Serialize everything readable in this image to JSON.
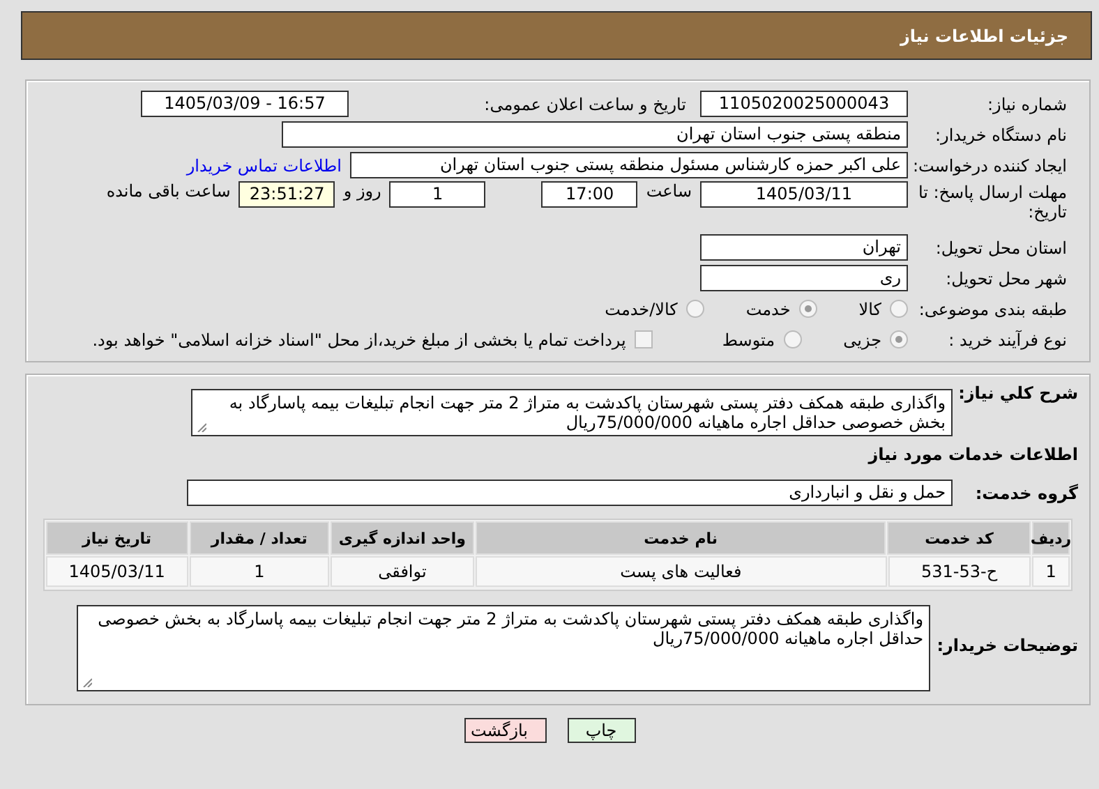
{
  "title": "جزئیات اطلاعات نیاز",
  "need_number": {
    "label": "شماره نیاز:",
    "value": "1105020025000043"
  },
  "announce": {
    "label": "تاریخ و ساعت اعلان عمومی:",
    "value": "1405/03/09 - 16:57"
  },
  "buyer": {
    "label": "نام دستگاه خریدار:",
    "value": "منطقه پستی جنوب استان تهران"
  },
  "creator": {
    "label": "ایجاد کننده درخواست:",
    "value": "علی اکبر حمزه کارشناس مسئول منطقه پستی جنوب استان تهران",
    "link": "اطلاعات تماس خریدار"
  },
  "deadline": {
    "label": "مهلت ارسال پاسخ: تا تاریخ:",
    "date": "1405/03/11",
    "time_label": "ساعت",
    "time": "17:00",
    "days": "1",
    "days_label": "روز و",
    "remaining": "23:51:27",
    "remaining_label": "ساعت باقی مانده"
  },
  "province": {
    "label": "استان محل تحویل:",
    "value": "تهران"
  },
  "city": {
    "label": "شهر محل تحویل:",
    "value": "ری"
  },
  "category": {
    "label": "طبقه بندی موضوعی:",
    "options": [
      {
        "label": "کالا",
        "selected": false
      },
      {
        "label": "خدمت",
        "selected": true
      },
      {
        "label": "کالا/خدمت",
        "selected": false
      }
    ]
  },
  "process": {
    "label": "نوع فرآیند خرید :",
    "options": [
      {
        "label": "جزیی",
        "selected": true
      },
      {
        "label": "متوسط",
        "selected": false
      }
    ],
    "treasury": {
      "label": "پرداخت تمام یا بخشی از مبلغ خرید،از محل \"اسناد خزانه اسلامی\" خواهد بود.",
      "checked": false
    }
  },
  "description": {
    "label": "شرح کلي نیاز:",
    "value": "واگذاری طبقه همکف دفتر پستی شهرستان پاکدشت به متراژ 2 متر جهت انجام تبلیغات بیمه پاسارگاد به بخش خصوصی حداقل اجاره ماهیانه 75/000/000ریال"
  },
  "services_heading": "اطلاعات خدمات مورد نیاز",
  "service_group": {
    "label": "گروه خدمت:",
    "value": "حمل و نقل و انبارداری"
  },
  "table": {
    "columns": [
      "ردیف",
      "کد خدمت",
      "نام خدمت",
      "واحد اندازه گیری",
      "تعداد / مقدار",
      "تاریخ نیاز"
    ],
    "rows": [
      [
        "1",
        "ح-53-531",
        "فعالیت های پست",
        "توافقی",
        "1",
        "1405/03/11"
      ]
    ]
  },
  "buyer_notes": {
    "label": "توضیحات خریدار:",
    "value": "واگذاری طبقه همکف دفتر پستی شهرستان پاکدشت به متراژ 2 متر جهت انجام تبلیغات بیمه پاسارگاد به بخش خصوصی حداقل اجاره ماهیانه 75/000/000ریال"
  },
  "buttons": [
    {
      "label": "چاپ",
      "kind": "print"
    },
    {
      "label": "بازگشت",
      "kind": "back"
    }
  ]
}
